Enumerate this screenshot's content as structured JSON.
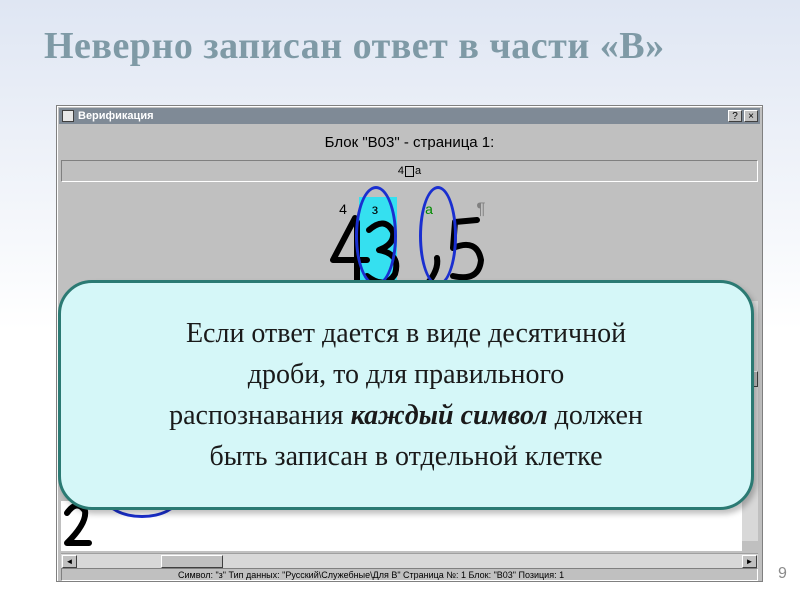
{
  "slide": {
    "title": "Неверно записан ответ в части «В»",
    "page_number": "9"
  },
  "window": {
    "title": "Верификация",
    "help_button": "?",
    "close_button": "×",
    "block_header": "Блок \"В03\" - страница 1:",
    "field_text_left": "4",
    "field_text_right": "а",
    "recognized_chars": [
      "4",
      "з",
      "а",
      "¶"
    ],
    "handwriting": "4з,5",
    "handwriting_lower": "2",
    "status_text": "Символ: \"з\"    Тип данных: \"Русский\\Служебные\\Для В\"    Страница №: 1    Блок: \"В03\"    Позиция: 1",
    "scroll_left_arrow": "◄",
    "scroll_right_arrow": "►"
  },
  "callout": {
    "line1": "Если ответ дается в виде десятичной",
    "line2": "дроби, то для правильного",
    "line3_before": "распознавания ",
    "line3_emph": "каждый символ",
    "line3_after": " должен",
    "line4": "быть записан в отдельной клетке"
  },
  "colors": {
    "title_color": "#7f9aa6",
    "callout_bg": "#d5f7f8",
    "callout_border": "#2b7a73",
    "oval_color": "#1a2fd0",
    "cell_highlight": "#35e0f0"
  }
}
